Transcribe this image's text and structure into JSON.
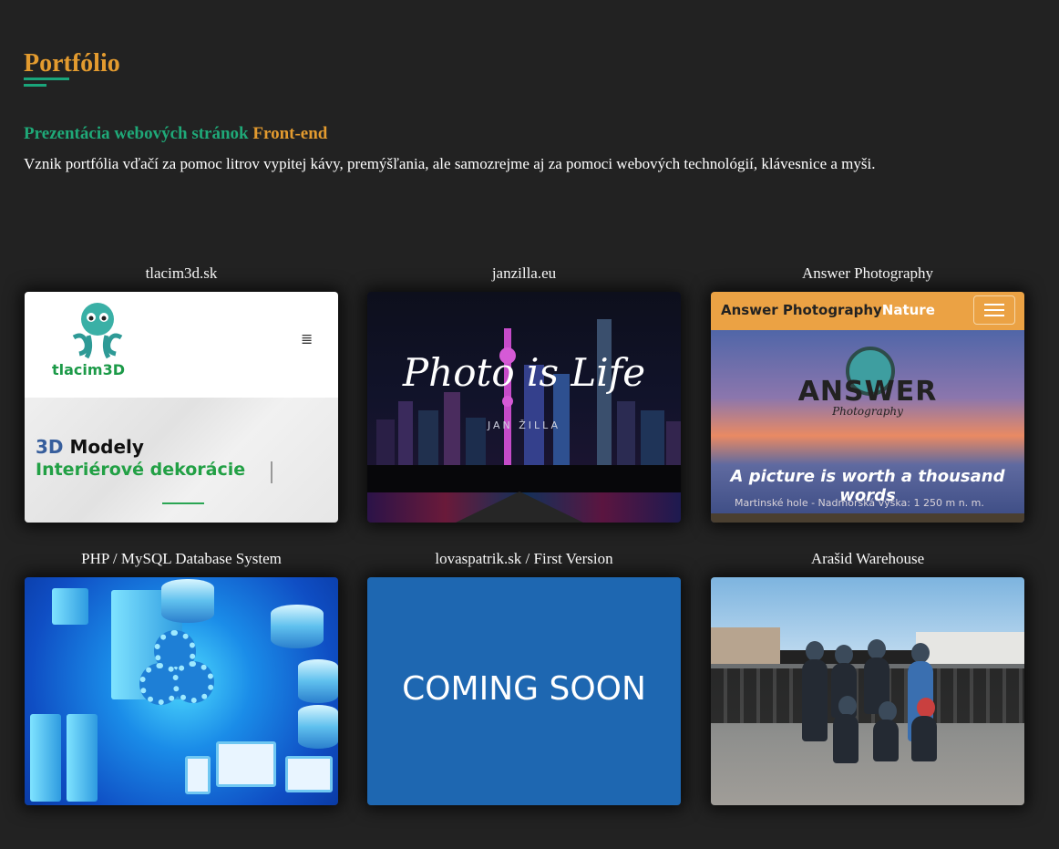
{
  "header": {
    "title": "Portfólio"
  },
  "intro": {
    "subtitle_green": "Prezentácia webových stránok",
    "subtitle_orange": "Front-end",
    "description": "Vznik portfólia vďačí za pomoc litrov vypitej kávy, premýšľania, ale samozrejme aj za pomoci webových technológií, klávesnice a myši."
  },
  "projects": [
    {
      "label": "tlacim3d.sk",
      "preview": {
        "logo_text": "tlacim3D",
        "menu_icon": "≣",
        "line1_prefix": "3D",
        "line1_rest": " Modely",
        "line2": "Interiérové dekorácie"
      }
    },
    {
      "label": "janzilla.eu",
      "preview": {
        "title": "Photo is Life",
        "subtitle": "JAN ŽILLA"
      }
    },
    {
      "label": "Answer Photography",
      "preview": {
        "brand": "Answer Photography",
        "brand_suffix": "Nature",
        "logo": "ANSWER",
        "logo_sub": "Photography",
        "quote": "A picture is worth a thousand words",
        "caption": "Martinské hole - Nadmorská výška: 1 250 m n. m."
      }
    },
    {
      "label": "PHP / MySQL Database System"
    },
    {
      "label": "lovaspatrik.sk / First Version",
      "preview": {
        "text": "COMING SOON"
      }
    },
    {
      "label": "Arašid Warehouse"
    }
  ],
  "colors": {
    "background": "#222222",
    "accent_orange": "#e39b2f",
    "accent_green": "#1fa978"
  }
}
